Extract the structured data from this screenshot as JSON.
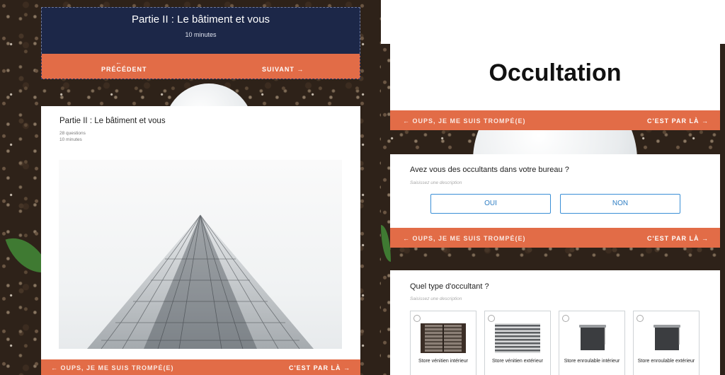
{
  "left": {
    "hero_title": "Partie II : Le bâtiment et vous",
    "hero_duration": "10 minutes",
    "nav_prev": "PRÉCÉDENT",
    "nav_prev_arrow": "←",
    "nav_next": "SUIVANT →",
    "card_title": "Partie II : Le bâtiment et vous",
    "card_questions": "28 questions",
    "card_minutes": "10 minutes",
    "back_label": "← OUPS, JE ME SUIS TROMPÉ(E)",
    "go_label": "C'EST PAR LÀ →"
  },
  "right": {
    "heading": "Occultation",
    "back_label": "← OUPS, JE ME SUIS TROMPÉ(E)",
    "go_label": "C'EST PAR LÀ →",
    "q1": {
      "label": "Avez vous des occultants dans votre bureau ?",
      "description": "Saisissez une description",
      "yes": "OUI",
      "no": "NON"
    },
    "q2": {
      "label": "Quel type d'occultant ?",
      "description": "Saisissez une description",
      "options": [
        {
          "label": "Store vénitien intérieur",
          "icon": "venetian-interior-image"
        },
        {
          "label": "Store vénitien extérieur",
          "icon": "venetian-exterior-image"
        },
        {
          "label": "Store enroulable intérieur",
          "icon": "roller-interior-image"
        },
        {
          "label": "Store enroulable extérieur",
          "icon": "roller-exterior-image"
        }
      ]
    }
  },
  "colors": {
    "accent_orange": "#e26c47",
    "navy": "#1c2748",
    "button_blue": "#3a8fd6"
  }
}
